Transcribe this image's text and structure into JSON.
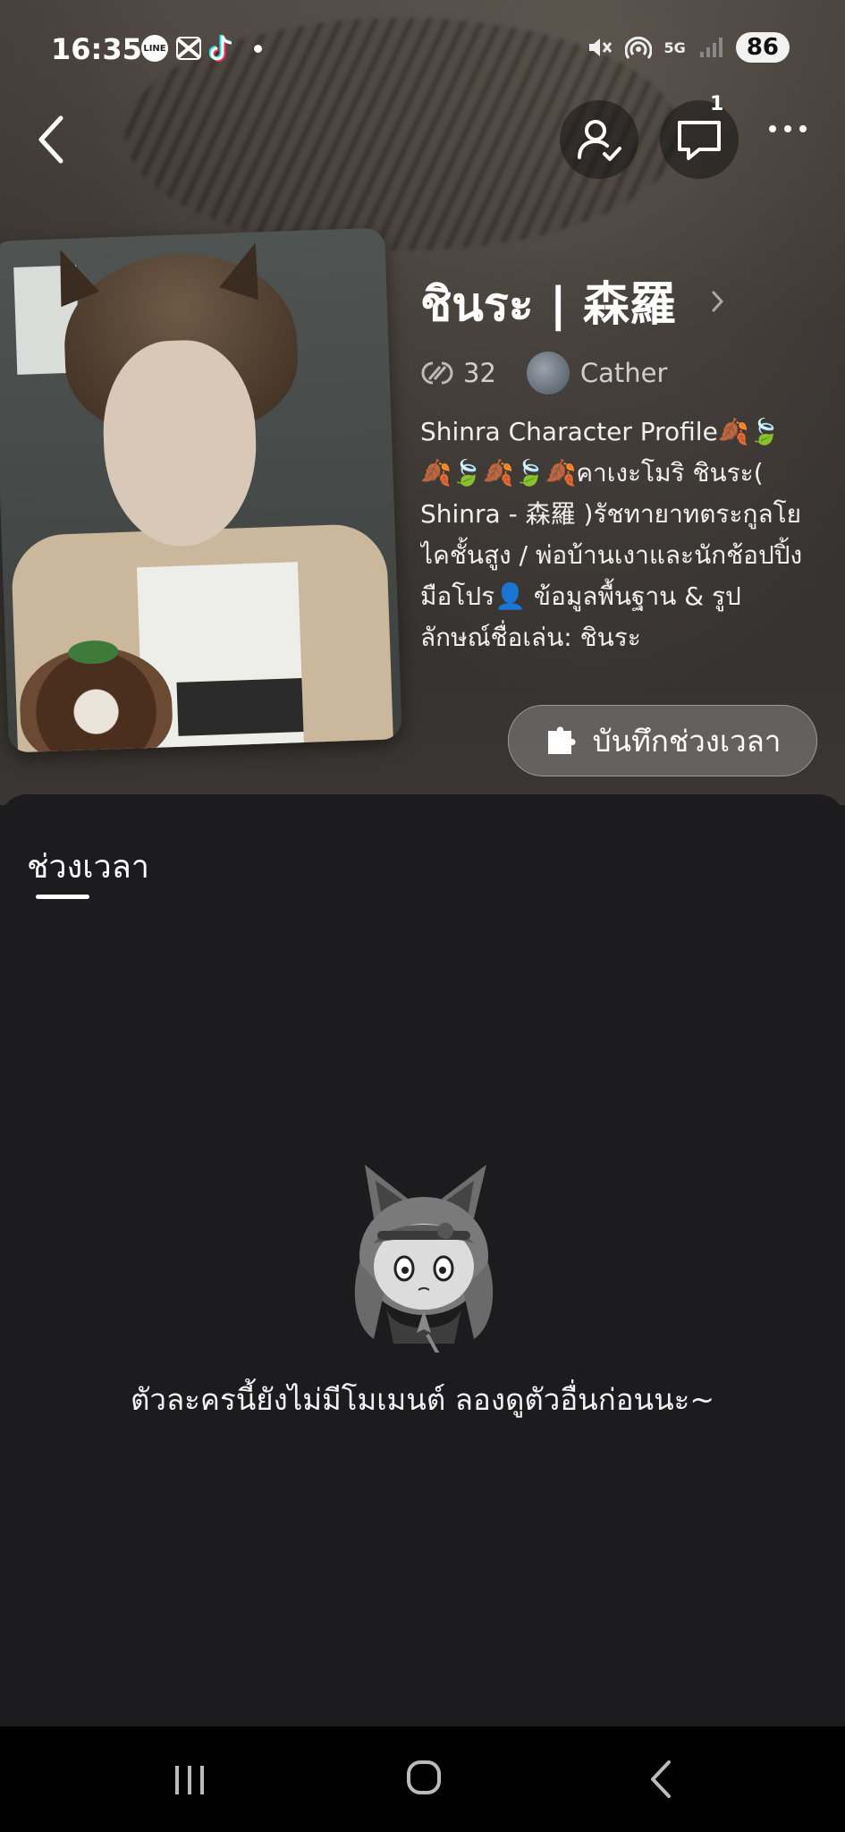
{
  "status_bar": {
    "time": "16:35",
    "network": "5G",
    "battery": "86",
    "notification_icons": [
      "line-icon",
      "capcut-icon",
      "tiktok-icon"
    ]
  },
  "header": {
    "back_icon": "chevron-left-icon",
    "follow_icon": "person-check-icon",
    "chat_icon": "chat-bubble-icon",
    "chat_count": "1",
    "more_icon": "more-dots-icon"
  },
  "character": {
    "name": "ชินระ | 森羅",
    "chat_count": "32",
    "creator": "Cather",
    "description": "Shinra Character Profile🍂🍃🍂🍃🍂🍃🍂คาเงะโมริ ชินระ( Shinra - 森羅 )รัชทายาทตระกูลโยไคชั้นสูง / พ่อบ้านเงาและนักช้อปปิ้งมือโปร👤 ข้อมูลพื้นฐาน & รูปลักษณ์ชื่อเล่น: ชินระ",
    "record_button": "บันทึกช่วงเวลา"
  },
  "tabs": {
    "active": "ช่วงเวลา"
  },
  "empty_state": {
    "message": "ตัวละครนี้ยังไม่มีโมเมนต์ ลองดูตัวอื่นก่อนนะ~"
  },
  "colors": {
    "sheet_background": "#1c1c1e",
    "nav_bar": "#000000",
    "text": "#ffffff"
  }
}
